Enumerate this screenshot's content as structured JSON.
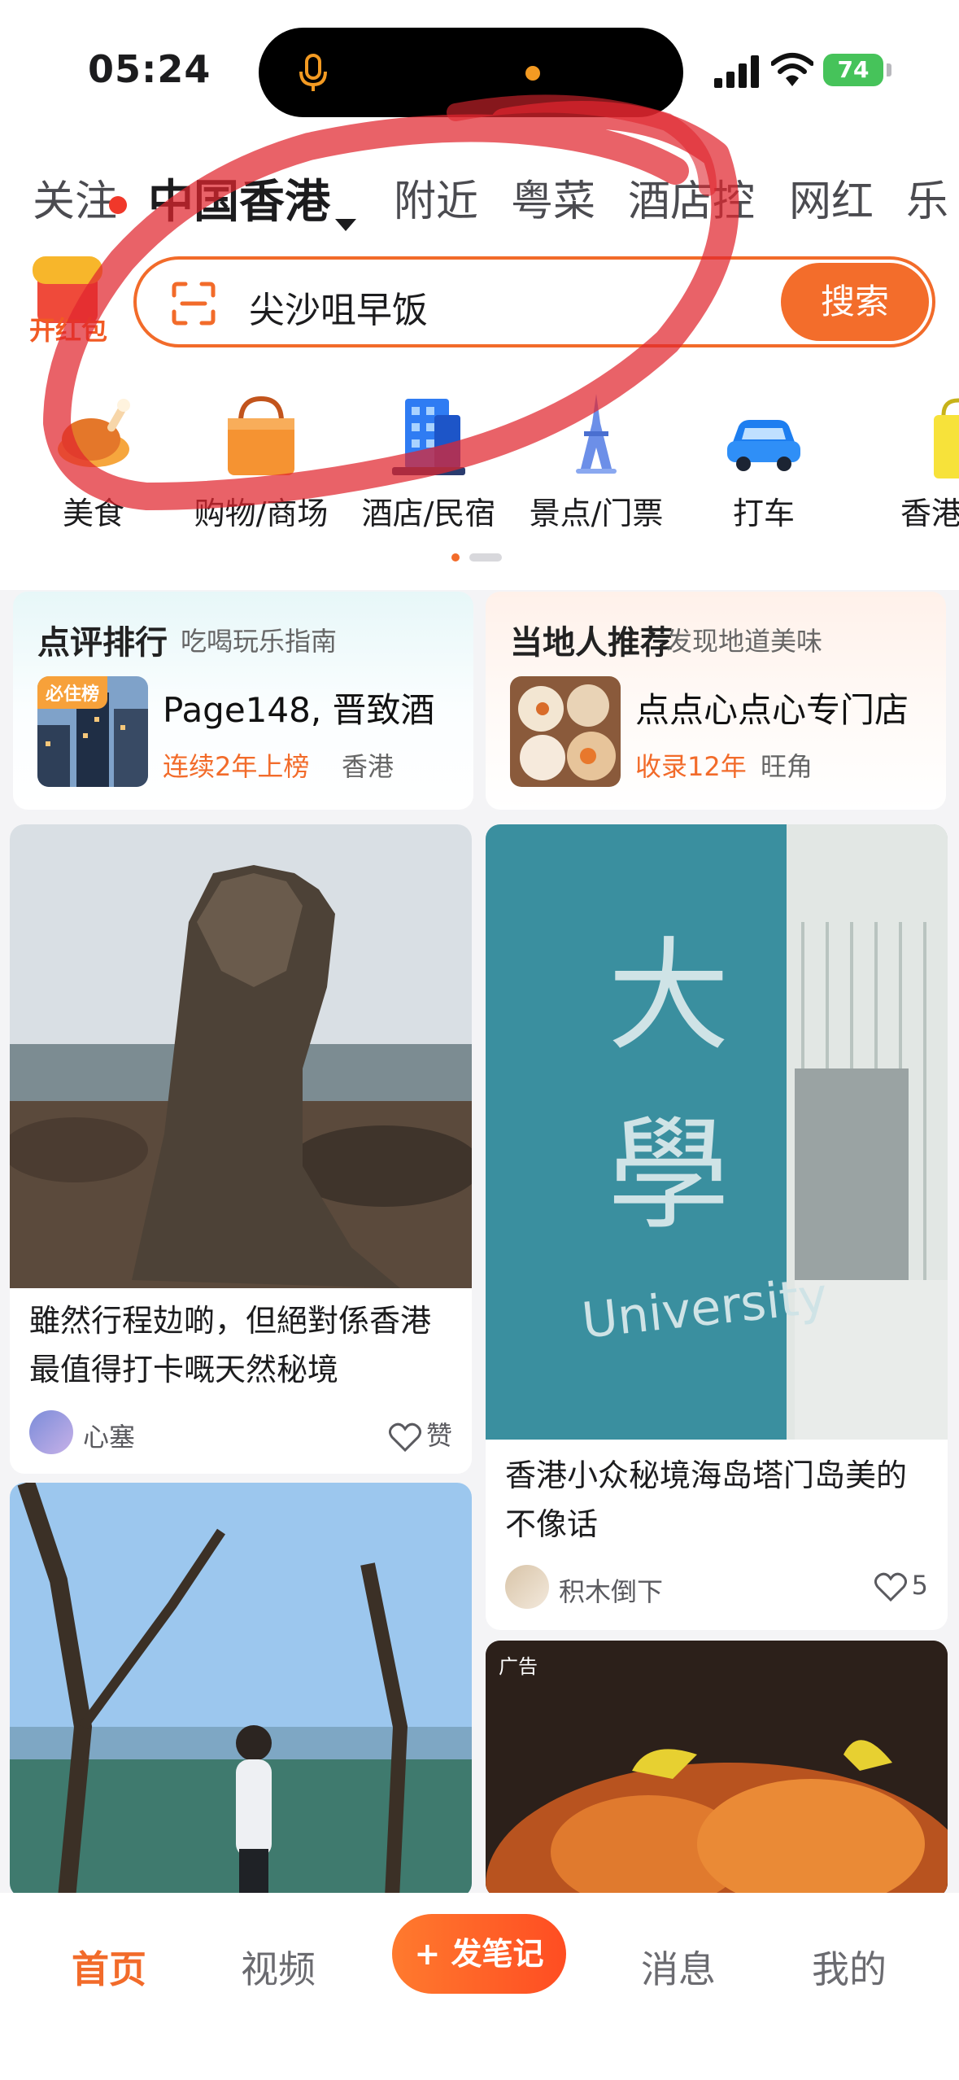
{
  "status_bar": {
    "time": "05:24",
    "battery": "74"
  },
  "top_tabs": [
    {
      "label": "关注",
      "has_dot": true
    },
    {
      "label": "中国香港",
      "active": true,
      "dropdown": true
    },
    {
      "label": "附近"
    },
    {
      "label": "粤菜"
    },
    {
      "label": "酒店控"
    },
    {
      "label": "网红"
    },
    {
      "label": "乐"
    }
  ],
  "red_packet": {
    "label": "开红包",
    "icon": "red-packet-icon"
  },
  "search": {
    "query": "尖沙咀早饭",
    "button": "搜索",
    "icon": "scan-icon"
  },
  "categories": [
    {
      "label": "美食",
      "icon": "roast-chicken-icon"
    },
    {
      "label": "购物/商场",
      "icon": "shopping-bag-icon"
    },
    {
      "label": "酒店/民宿",
      "icon": "hotel-icon"
    },
    {
      "label": "景点/门票",
      "icon": "eiffel-tower-icon"
    },
    {
      "label": "打车",
      "icon": "car-icon"
    },
    {
      "label": "香港",
      "icon": "shop-bag-icon"
    }
  ],
  "ranking_cards": [
    {
      "title": "点评排行",
      "subtitle": "吃喝玩乐指南",
      "badge": "必住榜",
      "name": "Page148, 晋致酒",
      "meta": "连续2年上榜",
      "location": "香港"
    },
    {
      "title": "当地人推荐",
      "subtitle": "发现地道美味",
      "name": "点点心点心专门店",
      "meta": "收录12年",
      "location": "旺角"
    }
  ],
  "feed": {
    "left": [
      {
        "title": "雖然行程攰啲，但絕對係香港最值得打卡嘅天然秘境",
        "author": "心塞",
        "likes": "赞"
      }
    ],
    "right": [
      {
        "title": "香港小众秘境海岛塔门岛美的不像话",
        "author": "积木倒下",
        "likes": "5",
        "image_text": [
          "大",
          "學",
          "University"
        ]
      },
      {
        "ad_tag": "广告"
      }
    ]
  },
  "bottom_nav": {
    "home": "首页",
    "video": "视频",
    "post": "+ 发笔记",
    "messages": "消息",
    "me": "我的"
  },
  "colors": {
    "accent": "#f26b2a",
    "annotation": "#e0262e"
  }
}
